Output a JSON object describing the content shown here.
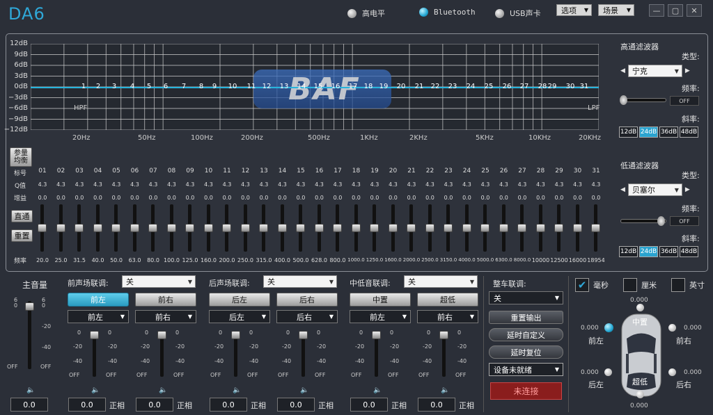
{
  "app": {
    "title": "DA6"
  },
  "inputs": [
    {
      "label": "高电平",
      "selected": false
    },
    {
      "label": "Bluetooth",
      "selected": true
    },
    {
      "label": "USB声卡",
      "selected": false
    }
  ],
  "menus": {
    "options": "选项",
    "scene": "场景"
  },
  "graph": {
    "y_labels": [
      "12dB",
      "9dB",
      "6dB",
      "3dB",
      "0dB",
      "−3dB",
      "−6dB",
      "−9dB",
      "−12dB"
    ],
    "x_labels": [
      "20Hz",
      "50Hz",
      "100Hz",
      "200Hz",
      "500Hz",
      "1KHz",
      "2KHz",
      "5KHz",
      "10KHz",
      "20KHz"
    ],
    "band_markers": [
      "1",
      "2",
      "3",
      "4",
      "5",
      "6",
      "7",
      "8",
      "9",
      "10",
      "11",
      "12",
      "13",
      "14",
      "15",
      "16",
      "17",
      "18",
      "19",
      "20",
      "21",
      "22",
      "23",
      "24",
      "25",
      "26",
      "27",
      "28",
      "29",
      "30",
      "31"
    ],
    "hpf": "HPF",
    "lpf": "LPF",
    "logo": "BAF"
  },
  "eq": {
    "param_eq_label": "参量均衡",
    "row_labels": {
      "band": "标号",
      "q": "Q值",
      "gain": "增益",
      "freq": "频率"
    },
    "bypass_label": "直通",
    "reset_label": "重置",
    "bands": [
      {
        "id": "01",
        "q": "4.3",
        "gain": "0.0",
        "freq": "20.0"
      },
      {
        "id": "02",
        "q": "4.3",
        "gain": "0.0",
        "freq": "25.0"
      },
      {
        "id": "03",
        "q": "4.3",
        "gain": "0.0",
        "freq": "31.5"
      },
      {
        "id": "04",
        "q": "4.3",
        "gain": "0.0",
        "freq": "40.0"
      },
      {
        "id": "05",
        "q": "4.3",
        "gain": "0.0",
        "freq": "50.0"
      },
      {
        "id": "06",
        "q": "4.3",
        "gain": "0.0",
        "freq": "63.0"
      },
      {
        "id": "07",
        "q": "4.3",
        "gain": "0.0",
        "freq": "80.0"
      },
      {
        "id": "08",
        "q": "4.3",
        "gain": "0.0",
        "freq": "100.0"
      },
      {
        "id": "09",
        "q": "4.3",
        "gain": "0.0",
        "freq": "125.0"
      },
      {
        "id": "10",
        "q": "4.3",
        "gain": "0.0",
        "freq": "160.0"
      },
      {
        "id": "11",
        "q": "4.3",
        "gain": "0.0",
        "freq": "200.0"
      },
      {
        "id": "12",
        "q": "4.3",
        "gain": "0.0",
        "freq": "250.0"
      },
      {
        "id": "13",
        "q": "4.3",
        "gain": "0.0",
        "freq": "315.0"
      },
      {
        "id": "14",
        "q": "4.3",
        "gain": "0.0",
        "freq": "400.0"
      },
      {
        "id": "15",
        "q": "4.3",
        "gain": "0.0",
        "freq": "500.0"
      },
      {
        "id": "16",
        "q": "4.3",
        "gain": "0.0",
        "freq": "628.0"
      },
      {
        "id": "17",
        "q": "4.3",
        "gain": "0.0",
        "freq": "800.0"
      },
      {
        "id": "18",
        "q": "4.3",
        "gain": "0.0",
        "freq": "1000.0"
      },
      {
        "id": "19",
        "q": "4.3",
        "gain": "0.0",
        "freq": "1250.0"
      },
      {
        "id": "20",
        "q": "4.3",
        "gain": "0.0",
        "freq": "1600.0"
      },
      {
        "id": "21",
        "q": "4.3",
        "gain": "0.0",
        "freq": "2000.0"
      },
      {
        "id": "22",
        "q": "4.3",
        "gain": "0.0",
        "freq": "2500.0"
      },
      {
        "id": "23",
        "q": "4.3",
        "gain": "0.0",
        "freq": "3150.0"
      },
      {
        "id": "24",
        "q": "4.3",
        "gain": "0.0",
        "freq": "4000.0"
      },
      {
        "id": "25",
        "q": "4.3",
        "gain": "0.0",
        "freq": "5000.0"
      },
      {
        "id": "26",
        "q": "4.3",
        "gain": "0.0",
        "freq": "6300.0"
      },
      {
        "id": "27",
        "q": "4.3",
        "gain": "0.0",
        "freq": "8000.0"
      },
      {
        "id": "28",
        "q": "4.3",
        "gain": "0.0",
        "freq": "10000"
      },
      {
        "id": "29",
        "q": "4.3",
        "gain": "0.0",
        "freq": "12500"
      },
      {
        "id": "30",
        "q": "4.3",
        "gain": "0.0",
        "freq": "16000"
      },
      {
        "id": "31",
        "q": "4.3",
        "gain": "0.0",
        "freq": "18954"
      }
    ]
  },
  "hp_filter": {
    "title": "高通滤波器",
    "type_label": "类型:",
    "type_value": "宁克",
    "freq_label": "频率:",
    "freq_value": "OFF",
    "slope_label": "斜率:",
    "slopes": [
      "12dB",
      "24dB",
      "36dB",
      "48dB"
    ],
    "active_slope": 1
  },
  "lp_filter": {
    "title": "低通滤波器",
    "type_label": "类型:",
    "type_value": "贝塞尔",
    "freq_label": "频率:",
    "freq_value": "OFF",
    "slope_label": "斜率:",
    "slopes": [
      "12dB",
      "24dB",
      "36dB",
      "48dB"
    ],
    "active_slope": 1
  },
  "master": {
    "label": "主音量",
    "scale": [
      "6",
      "0",
      "-20",
      "-40",
      "OFF"
    ],
    "value": "0.0"
  },
  "channel_scale": [
    "0",
    "-20",
    "-40",
    "OFF"
  ],
  "groups": [
    {
      "link_label": "前声场联调:",
      "link_value": "关",
      "channels": [
        {
          "name": "前左",
          "source": "前左",
          "value": "0.0",
          "active": true
        },
        {
          "name": "前右",
          "source": "前右",
          "value": "0.0",
          "active": false
        }
      ],
      "phase_label": "正相"
    },
    {
      "link_label": "后声场联调:",
      "link_value": "关",
      "channels": [
        {
          "name": "后左",
          "source": "后左",
          "value": "0.0",
          "active": false
        },
        {
          "name": "后右",
          "source": "后右",
          "value": "0.0",
          "active": false
        }
      ],
      "phase_label": "正相"
    },
    {
      "link_label": "中低音联调:",
      "link_value": "关",
      "channels": [
        {
          "name": "中置",
          "source": "前左",
          "value": "0.0",
          "active": false
        },
        {
          "name": "超低",
          "source": "前右",
          "value": "0.0",
          "active": false
        }
      ],
      "phase_label": "正相"
    }
  ],
  "car_link": {
    "label": "整车联调:",
    "value": "关",
    "reset_output": "重置输出",
    "delay_custom": "延时自定义",
    "delay_reset": "延时复位",
    "device_status": "设备未就绪",
    "connect": "未连接"
  },
  "units": [
    {
      "label": "毫秒",
      "checked": true
    },
    {
      "label": "厘米",
      "checked": false
    },
    {
      "label": "英寸",
      "checked": false
    }
  ],
  "delay": {
    "top": "0.000",
    "bottom": "0.000",
    "front_left": {
      "label": "前左",
      "value": "0.000"
    },
    "front_right": {
      "label": "前右",
      "value": "0.000"
    },
    "rear_left": {
      "label": "后左",
      "value": "0.000"
    },
    "rear_right": {
      "label": "后右",
      "value": "0.000"
    },
    "center": "中置",
    "sub": "超低"
  },
  "colors": {
    "accent": "#2fa8d8",
    "curve": "#27b4dc",
    "connect_bg": "#8a1d1d"
  }
}
